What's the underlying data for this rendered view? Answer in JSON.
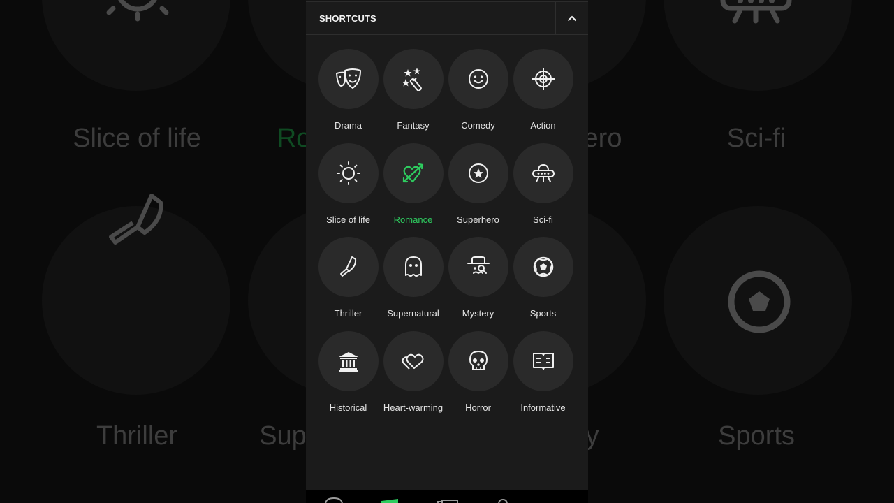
{
  "colors": {
    "accent": "#2ecc5f",
    "panel_bg": "#1b1b1b",
    "circle_bg": "#2a2a2a",
    "text": "#e4e4e4"
  },
  "background": {
    "labels": [
      "Slice of life",
      "Ro",
      "ero",
      "Sci-fi",
      "Thriller",
      "Sup",
      "y",
      "Sports"
    ]
  },
  "header": {
    "title": "SHORTCUTS",
    "collapse_icon": "chevron-up-icon"
  },
  "shortcuts": [
    {
      "label": "Drama",
      "icon": "drama-masks-icon",
      "active": false
    },
    {
      "label": "Fantasy",
      "icon": "magic-wand-icon",
      "active": false
    },
    {
      "label": "Comedy",
      "icon": "smiley-icon",
      "active": false
    },
    {
      "label": "Action",
      "icon": "crosshair-icon",
      "active": false
    },
    {
      "label": "Slice of life",
      "icon": "sun-icon",
      "active": false
    },
    {
      "label": "Romance",
      "icon": "heart-arrow-icon",
      "active": true
    },
    {
      "label": "Superhero",
      "icon": "star-badge-icon",
      "active": false
    },
    {
      "label": "Sci-fi",
      "icon": "ufo-icon",
      "active": false
    },
    {
      "label": "Thriller",
      "icon": "knife-icon",
      "active": false
    },
    {
      "label": "Supernatural",
      "icon": "ghost-icon",
      "active": false
    },
    {
      "label": "Mystery",
      "icon": "detective-icon",
      "active": false
    },
    {
      "label": "Sports",
      "icon": "soccer-ball-icon",
      "active": false
    },
    {
      "label": "Historical",
      "icon": "museum-icon",
      "active": false
    },
    {
      "label": "Heart-warming",
      "icon": "two-hearts-icon",
      "active": false
    },
    {
      "label": "Horror",
      "icon": "skull-icon",
      "active": false
    },
    {
      "label": "Informative",
      "icon": "open-book-icon",
      "active": false
    }
  ],
  "bottom_nav": {
    "items": [
      "home-icon",
      "originals-icon",
      "library-icon",
      "profile-icon"
    ]
  }
}
